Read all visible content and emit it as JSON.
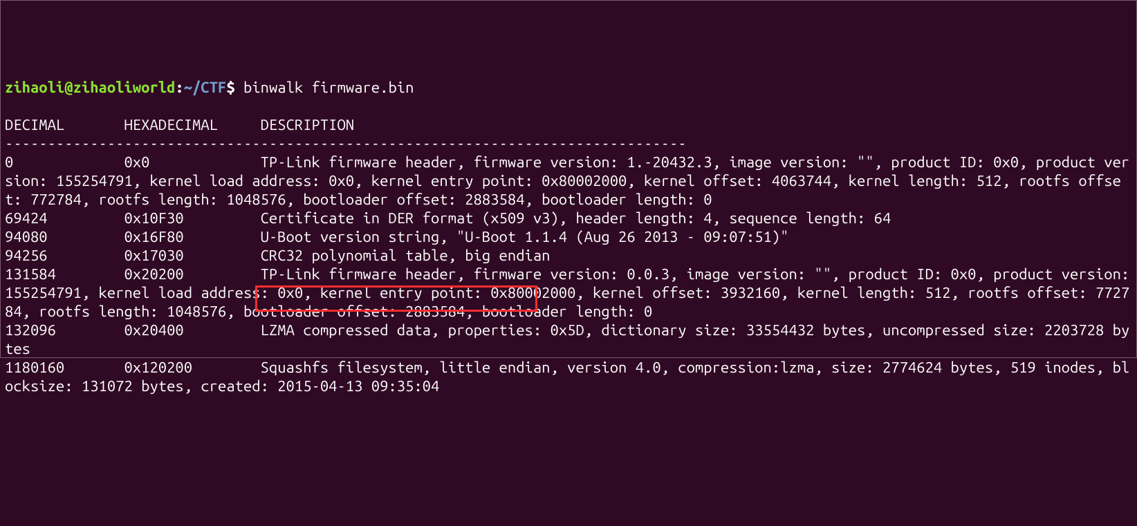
{
  "prompt": {
    "user": "zihaoli",
    "at": "@",
    "host": "zihaoliworld",
    "colon": ":",
    "path": "~/CTF",
    "dollar": "$ ",
    "command": "binwalk firmware.bin"
  },
  "blank1": "",
  "header": "DECIMAL       HEXADECIMAL     DESCRIPTION",
  "rule": "--------------------------------------------------------------------------------",
  "lines": [
    "0             0x0             TP-Link firmware header, firmware version: 1.-20432.3, image version: \"\", product ID: 0x0, product version: 155254791, kernel load address: 0x0, kernel entry point: 0x80002000, kernel offset: 4063744, kernel length: 512, rootfs offset: 772784, rootfs length: 1048576, bootloader offset: 2883584, bootloader length: 0",
    "69424         0x10F30         Certificate in DER format (x509 v3), header length: 4, sequence length: 64",
    "94080         0x16F80         U-Boot version string, \"U-Boot 1.1.4 (Aug 26 2013 - 09:07:51)\"",
    "94256         0x17030         CRC32 polynomial table, big endian",
    "131584        0x20200         TP-Link firmware header, firmware version: 0.0.3, image version: \"\", product ID: 0x0, product version: 155254791, kernel load address: 0x0, kernel entry point: 0x80002000, kernel offset: 3932160, kernel length: 512, rootfs offset: 772784, rootfs length: 1048576, bootloader offset: 2883584, bootloader length: 0",
    "132096        0x20400         LZMA compressed data, properties: 0x5D, dictionary size: 33554432 bytes, uncompressed size: 2203728 bytes",
    "1180160       0x120200        Squashfs filesystem, little endian, version 4.0, compression:lzma, size: 2774624 bytes, 519 inodes, blocksize: 131072 bytes, created: 2015-04-13 09:35:04"
  ],
  "chart_data": {
    "type": "table",
    "columns": [
      "DECIMAL",
      "HEXADECIMAL",
      "DESCRIPTION"
    ],
    "rows": [
      {
        "decimal": 0,
        "hex": "0x0",
        "description": "TP-Link firmware header, firmware version: 1.-20432.3, image version: \"\", product ID: 0x0, product version: 155254791, kernel load address: 0x0, kernel entry point: 0x80002000, kernel offset: 4063744, kernel length: 512, rootfs offset: 772784, rootfs length: 1048576, bootloader offset: 2883584, bootloader length: 0"
      },
      {
        "decimal": 69424,
        "hex": "0x10F30",
        "description": "Certificate in DER format (x509 v3), header length: 4, sequence length: 64"
      },
      {
        "decimal": 94080,
        "hex": "0x16F80",
        "description": "U-Boot version string, \"U-Boot 1.1.4 (Aug 26 2013 - 09:07:51)\""
      },
      {
        "decimal": 94256,
        "hex": "0x17030",
        "description": "CRC32 polynomial table, big endian"
      },
      {
        "decimal": 131584,
        "hex": "0x20200",
        "description": "TP-Link firmware header, firmware version: 0.0.3, image version: \"\", product ID: 0x0, product version: 155254791, kernel load address: 0x0, kernel entry point: 0x80002000, kernel offset: 3932160, kernel length: 512, rootfs offset: 772784, rootfs length: 1048576, bootloader offset: 2883584, bootloader length: 0"
      },
      {
        "decimal": 132096,
        "hex": "0x20400",
        "description": "LZMA compressed data, properties: 0x5D, dictionary size: 33554432 bytes, uncompressed size: 2203728 bytes"
      },
      {
        "decimal": 1180160,
        "hex": "0x120200",
        "description": "Squashfs filesystem, little endian, version 4.0, compression:lzma, size: 2774624 bytes, 519 inodes, blocksize: 131072 bytes, created: 2015-04-13 09:35:04"
      }
    ]
  }
}
